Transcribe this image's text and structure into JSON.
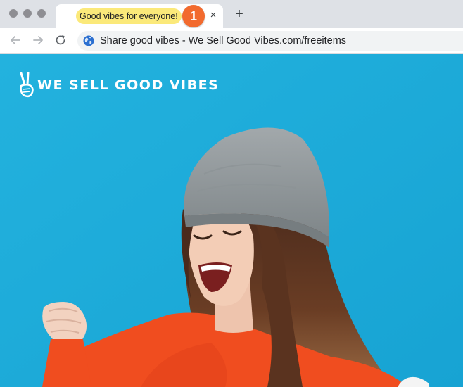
{
  "window": {
    "controls": [
      "close",
      "minimize",
      "zoom"
    ]
  },
  "tab": {
    "title": "Good vibes for everyone!",
    "step_badge": "1",
    "close_glyph": "×"
  },
  "new_tab_glyph": "+",
  "toolbar": {
    "back_icon": "arrow-left-icon",
    "forward_icon": "arrow-right-icon",
    "reload_icon": "reload-icon",
    "site_icon": "globe-icon",
    "url_text": "Share good vibes - We Sell Good Vibes.com/freeitems"
  },
  "page": {
    "brand": "WE SELL GOOD VIBES",
    "logo_icon": "peace-hand-icon",
    "hero_image": "cheering-woman-in-grey-beanie",
    "colors": {
      "background": "#1faedb",
      "highlight": "#fbe97a",
      "badge": "#f26a2e",
      "sweater": "#f04d1f",
      "beanie": "#8d9396"
    }
  }
}
